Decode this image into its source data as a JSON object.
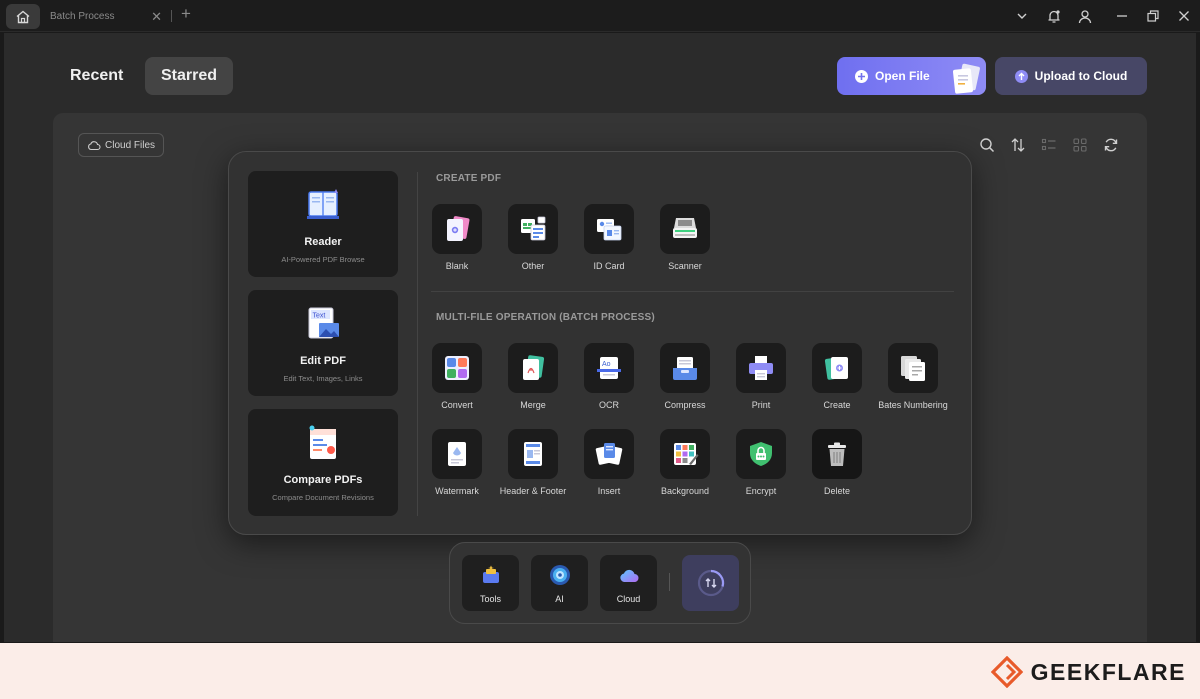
{
  "titlebar": {
    "tab_title": "Batch Process"
  },
  "main": {
    "tabs": [
      {
        "label": "Recent"
      },
      {
        "label": "Starred"
      }
    ],
    "open_file_label": "Open File",
    "upload_label": "Upload to Cloud",
    "cloud_files_label": "Cloud Files"
  },
  "popup": {
    "cards": [
      {
        "title": "Reader",
        "subtitle": "AI-Powered PDF Browse"
      },
      {
        "title": "Edit PDF",
        "subtitle": "Edit Text, Images, Links"
      },
      {
        "title": "Compare PDFs",
        "subtitle": "Compare Document Revisions"
      }
    ],
    "create_title": "CREATE PDF",
    "create_items": [
      "Blank",
      "Other",
      "ID Card",
      "Scanner"
    ],
    "batch_title": "MULTI-FILE OPERATION (BATCH PROCESS)",
    "batch_items": [
      "Convert",
      "Merge",
      "OCR",
      "Compress",
      "Print",
      "Create",
      "Bates Numbering",
      "Watermark",
      "Header & Footer",
      "Insert",
      "Background",
      "Encrypt",
      "Delete"
    ],
    "edit_icon_text": "Text",
    "ocr_icon_text": "Ao"
  },
  "dock": {
    "items": [
      "Tools",
      "AI",
      "Cloud"
    ]
  },
  "footer": {
    "brand": "GEEKFLARE"
  },
  "colors": {
    "accent": "#7b7bf2",
    "upload": "#474766",
    "brand_orange": "#e85a2a"
  }
}
